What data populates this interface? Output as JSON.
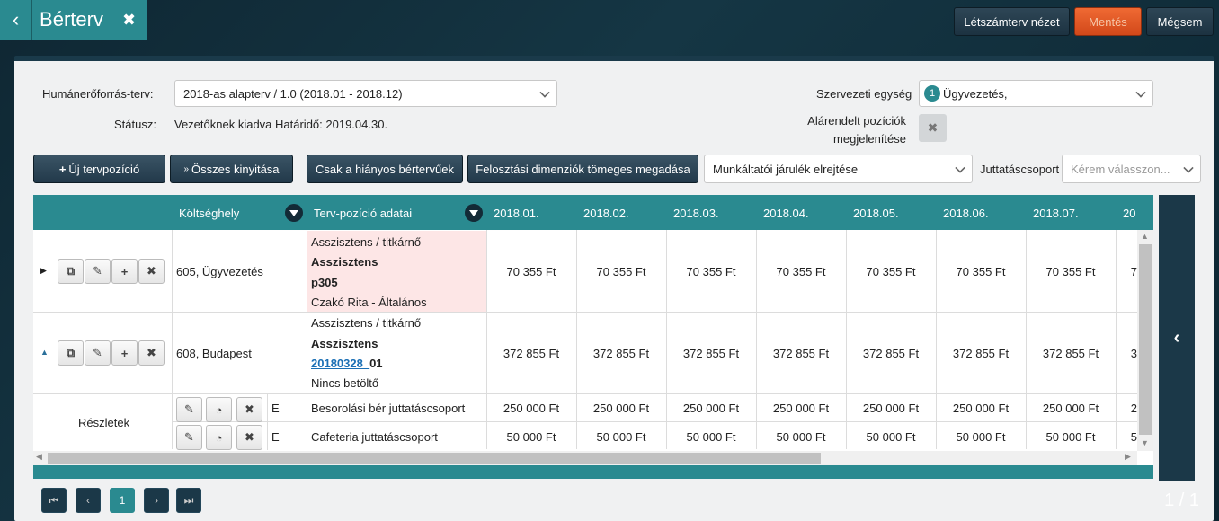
{
  "header": {
    "title": "Bérterv",
    "btn_headcount": "Létszámterv nézet",
    "btn_save": "Mentés",
    "btn_cancel": "Mégsem"
  },
  "form": {
    "hr_plan_label": "Humánerőforrás-terv:",
    "hr_plan_value": "2018-as alapterv / 1.0 (2018.01 - 2018.12)",
    "status_label": "Státusz:",
    "status_value": "Vezetőknek kiadva Határidő: 2019.04.30.",
    "org_label": "Szervezeti egység",
    "org_count": "1",
    "org_value": "Ügyvezetés,",
    "sub_label_1": "Alárendelt pozíciók",
    "sub_label_2": "megjelenítése"
  },
  "toolbar": {
    "new_position": "Új tervpozíció",
    "expand_all": "Összes kinyitása",
    "only_missing": "Csak a hiányos bértervűek",
    "mass_dims": "Felosztási dimenziók tömeges megadása",
    "contrib_select": "Munkáltatói járulék elrejtése",
    "benefit_label": "Juttatáscsoport",
    "benefit_placeholder": "Kérem válasszon..."
  },
  "grid": {
    "col_cost": "Költséghely",
    "col_pos": "Terv-pozíció adatai",
    "months": [
      "2018.01.",
      "2018.02.",
      "2018.03.",
      "2018.04.",
      "2018.05.",
      "2018.06.",
      "2018.07.",
      "20"
    ],
    "rows": [
      {
        "cost": "605, Ügyvezetés",
        "l1": "Asszisztens / titkárnő",
        "l2": "Asszisztens",
        "l3": "p305",
        "l3b": "",
        "l4": "Czakó Rita - Általános",
        "vals": [
          "70 355 Ft",
          "70 355 Ft",
          "70 355 Ft",
          "70 355 Ft",
          "70 355 Ft",
          "70 355 Ft",
          "70 355 Ft",
          "7"
        ]
      },
      {
        "cost": "608, Budapest",
        "l1": "Asszisztens / titkárnő",
        "l2": "Asszisztens",
        "l3": "20180328_",
        "l3b": "01",
        "l4": "Nincs betöltő",
        "vals": [
          "372 855 Ft",
          "372 855 Ft",
          "372 855 Ft",
          "372 855 Ft",
          "372 855 Ft",
          "372 855 Ft",
          "372 855 Ft",
          "3"
        ]
      }
    ],
    "details_label": "Részletek",
    "details": [
      {
        "flag": "E",
        "name": "Besorolási bér juttatáscsoport",
        "vals": [
          "250 000 Ft",
          "250 000 Ft",
          "250 000 Ft",
          "250 000 Ft",
          "250 000 Ft",
          "250 000 Ft",
          "250 000 Ft",
          "2"
        ]
      },
      {
        "flag": "E",
        "name": "Cafeteria juttatáscsoport",
        "vals": [
          "50 000 Ft",
          "50 000 Ft",
          "50 000 Ft",
          "50 000 Ft",
          "50 000 Ft",
          "50 000 Ft",
          "50 000 Ft",
          "5"
        ]
      }
    ]
  },
  "pager": {
    "page": "1",
    "summary": "1 / 1"
  },
  "colors": {
    "accent": "#2a8a90",
    "save": "#e0501e",
    "highlight": "#fde6e6"
  }
}
